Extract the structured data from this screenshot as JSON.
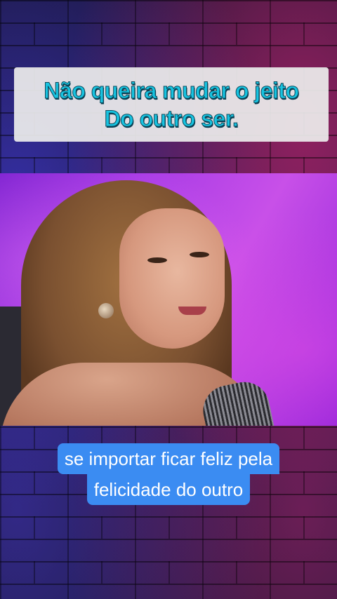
{
  "top_caption": {
    "line1": "Não queira mudar o jeito",
    "line2": "Do outro ser."
  },
  "subtitle": {
    "line1": "se importar ficar feliz pela",
    "line2": "felicidade do outro"
  },
  "colors": {
    "caption_text": "#17c3e0",
    "subtitle_bg": "#3b8cf2",
    "video_bg": "#a83be6"
  }
}
